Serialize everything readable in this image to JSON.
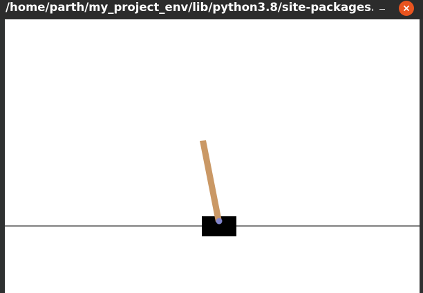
{
  "window": {
    "title": "/home/parth/my_project_env/lib/python3.8/site-packages..."
  },
  "controls": {
    "minimize_icon": "minimize-icon",
    "close_icon": "close-icon",
    "close_color": "#e9541f"
  },
  "scene": {
    "cart_color": "#000000",
    "pole_color": "#ca9865",
    "axle_color": "#8184cb",
    "track_color": "#000000",
    "pole_angle_deg": -11
  }
}
